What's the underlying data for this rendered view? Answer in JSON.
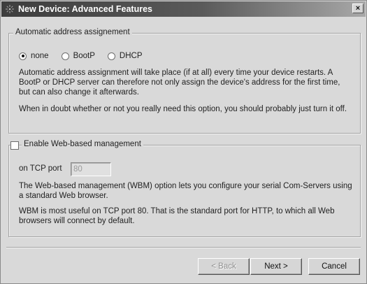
{
  "window": {
    "title": "New Device: Advanced Features",
    "close_glyph": "×"
  },
  "address_group": {
    "legend": "Automatic address assignement",
    "options": [
      {
        "label": "none",
        "selected": true
      },
      {
        "label": "BootP",
        "selected": false
      },
      {
        "label": "DHCP",
        "selected": false
      }
    ],
    "description": "Automatic address assignment will take place (if at all) every time your device restarts. A BootP or DHCP server can therefore not only assign the device's address for the first time, but can also change it afterwards.",
    "advice": "When in doubt whether or not you really need this option, you should probably just turn it off."
  },
  "wbm_group": {
    "checkbox_label": "Enable Web-based management",
    "checked": false,
    "tcp_port_label": "on TCP port",
    "tcp_port_value": "80",
    "description": "The Web-based management (WBM) option lets you configure your serial Com-Servers using a standard Web browser.",
    "note": "WBM is most useful on TCP port 80. That is the standard port for HTTP, to which all Web browsers will connect by default."
  },
  "buttons": {
    "back": "< Back",
    "next": "Next >",
    "cancel": "Cancel"
  }
}
